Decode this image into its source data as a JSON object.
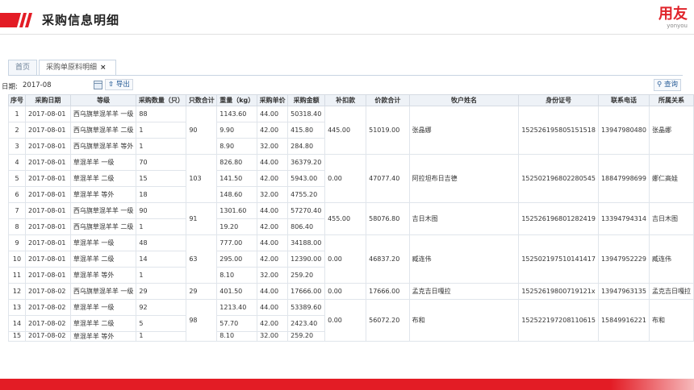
{
  "header": {
    "title": "采购信息明细",
    "logo": {
      "main": "用友",
      "sub": "yonyou"
    },
    "colors": {
      "accent": "#e31c25",
      "tab_border": "#c8d4e2",
      "header_bg": "#eef2f7"
    }
  },
  "tabs": [
    {
      "label": "首页"
    },
    {
      "label": "采购单原料明细",
      "close": "×"
    }
  ],
  "toolbar": {
    "date_label": "日期:",
    "date_value": "2017-08",
    "calendar_icon": "calendar-icon",
    "export_label": "导出",
    "export_icon": "upload-icon",
    "query_label": "查询",
    "query_icon": "search-icon"
  },
  "table": {
    "columns": [
      "序号",
      "采购日期",
      "等级",
      "采购数量（只）",
      "只数合计",
      "重量（kg）",
      "采购单价",
      "采购金额",
      "补扣款",
      "价款合计",
      "牧户姓名",
      "身份证号",
      "联系电话",
      "所属关系"
    ],
    "rows": [
      {
        "no": "1",
        "date": "2017-08-01",
        "grade": "西乌旗草混羊羊 一级",
        "qty": "88",
        "weight": "1143.60",
        "price": "44.00",
        "amount": "50318.40"
      },
      {
        "no": "2",
        "date": "2017-08-01",
        "grade": "西乌旗草混羊羊 二级",
        "qty": "1",
        "weight": "9.90",
        "price": "42.00",
        "amount": "415.80"
      },
      {
        "no": "3",
        "date": "2017-08-01",
        "grade": "西乌旗草混羊羊 等外",
        "qty": "1",
        "weight": "8.90",
        "price": "32.00",
        "amount": "284.80"
      },
      {
        "no": "4",
        "date": "2017-08-01",
        "grade": "草混羊羊 一级",
        "qty": "70",
        "weight": "826.80",
        "price": "44.00",
        "amount": "36379.20"
      },
      {
        "no": "5",
        "date": "2017-08-01",
        "grade": "草混羊羊 二级",
        "qty": "15",
        "weight": "141.50",
        "price": "42.00",
        "amount": "5943.00"
      },
      {
        "no": "6",
        "date": "2017-08-01",
        "grade": "草混羊羊 等外",
        "qty": "18",
        "weight": "148.60",
        "price": "32.00",
        "amount": "4755.20"
      },
      {
        "no": "7",
        "date": "2017-08-01",
        "grade": "西乌旗草混羊羊 一级",
        "qty": "90",
        "weight": "1301.60",
        "price": "44.00",
        "amount": "57270.40"
      },
      {
        "no": "8",
        "date": "2017-08-01",
        "grade": "西乌旗草混羊羊 二级",
        "qty": "1",
        "weight": "19.20",
        "price": "42.00",
        "amount": "806.40"
      },
      {
        "no": "9",
        "date": "2017-08-01",
        "grade": "草混羊羊 一级",
        "qty": "48",
        "weight": "777.00",
        "price": "44.00",
        "amount": "34188.00"
      },
      {
        "no": "10",
        "date": "2017-08-01",
        "grade": "草混羊羊 二级",
        "qty": "14",
        "weight": "295.00",
        "price": "42.00",
        "amount": "12390.00"
      },
      {
        "no": "11",
        "date": "2017-08-01",
        "grade": "草混羊羊 等外",
        "qty": "1",
        "weight": "8.10",
        "price": "32.00",
        "amount": "259.20"
      },
      {
        "no": "12",
        "date": "2017-08-02",
        "grade": "西乌旗草混羊羊 一级",
        "qty": "29",
        "weight": "401.50",
        "price": "44.00",
        "amount": "17666.00"
      },
      {
        "no": "13",
        "date": "2017-08-02",
        "grade": "草混羊羊 一级",
        "qty": "92",
        "weight": "1213.40",
        "price": "44.00",
        "amount": "53389.60"
      },
      {
        "no": "14",
        "date": "2017-08-02",
        "grade": "草混羊羊 二级",
        "qty": "5",
        "weight": "57.70",
        "price": "42.00",
        "amount": "2423.40"
      },
      {
        "no": "15",
        "date": "2017-08-02",
        "grade": "草混羊羊 等外",
        "qty": "1",
        "weight": "8.10",
        "price": "32.00",
        "amount": "259.20"
      }
    ],
    "groups": [
      {
        "total": "90",
        "deduction": "445.00",
        "sum": "51019.00",
        "herder": "张晶娜",
        "id_no": "152526195805151518",
        "phone": "13947980480",
        "relation": "张晶娜"
      },
      {
        "total": "103",
        "deduction": "0.00",
        "sum": "47077.40",
        "herder": "阿拉坦布日吉德",
        "id_no": "152502196802280545",
        "phone": "18847998699",
        "relation": "娜仁高娃"
      },
      {
        "total": "91",
        "deduction": "455.00",
        "sum": "58076.80",
        "herder": "吉日木图",
        "id_no": "152526196801282419",
        "phone": "13394794314",
        "relation": "吉日木图"
      },
      {
        "total": "63",
        "deduction": "0.00",
        "sum": "46837.20",
        "herder": "臧连伟",
        "id_no": "152502197510141417",
        "phone": "13947952229",
        "relation": "臧连伟"
      },
      {
        "total": "29",
        "deduction": "0.00",
        "sum": "17666.00",
        "herder": "孟克吉日嘎拉",
        "id_no": "15252619800719121x",
        "phone": "13947963135",
        "relation": "孟克吉日嘎拉"
      },
      {
        "total": "98",
        "deduction": "0.00",
        "sum": "56072.20",
        "herder": "布和",
        "id_no": "152522197208110615",
        "phone": "15849916221",
        "relation": "布和"
      }
    ]
  }
}
